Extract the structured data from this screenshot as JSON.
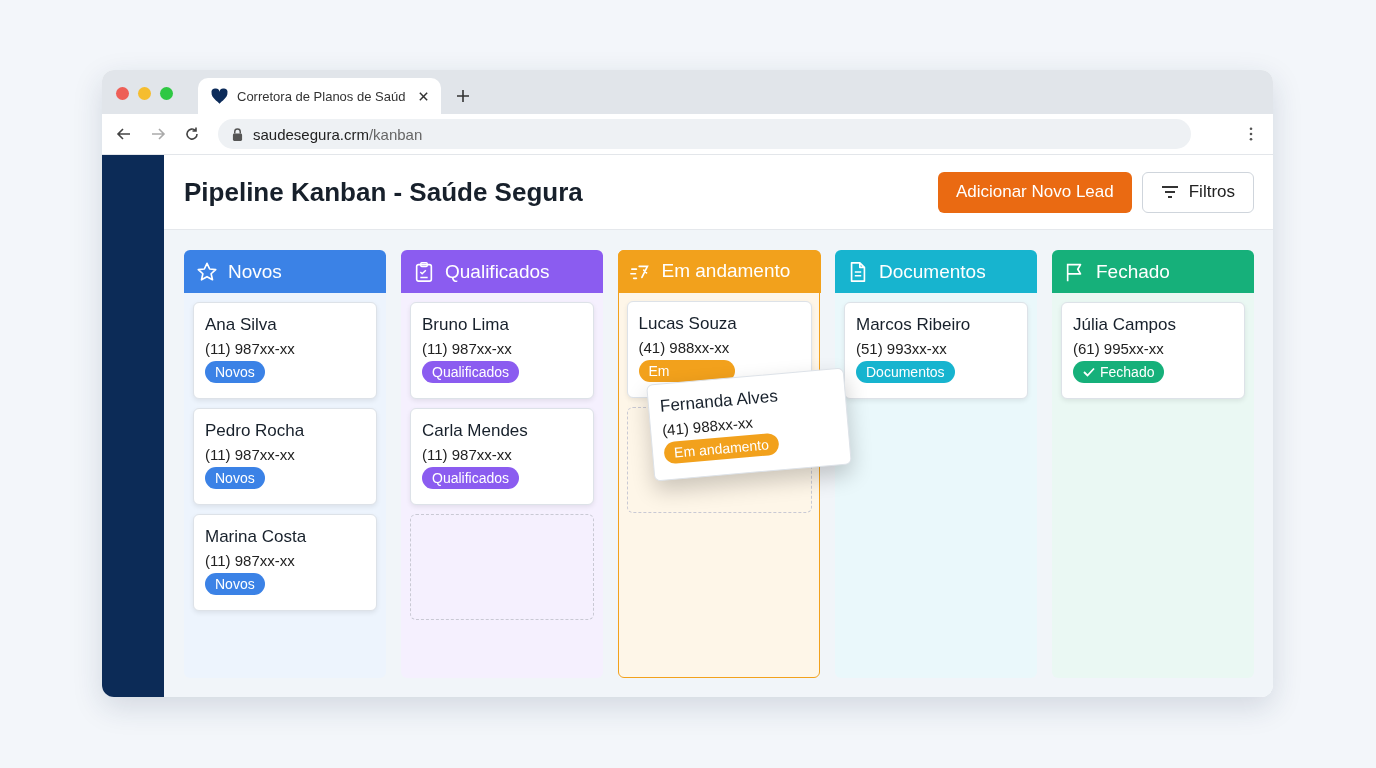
{
  "browser": {
    "tab_title": "Corretora de Planos de Saúd",
    "url_domain": "saudesegura.crm",
    "url_path": "/kanban"
  },
  "header": {
    "title": "Pipeline Kanban - Saúde Segura",
    "primary_button": "Adicionar Novo Lead",
    "filter_button": "Filtros"
  },
  "columns": [
    {
      "title": "Novos",
      "kind": "new",
      "color": "#3b82e6",
      "highlighted": false,
      "drop_zone": false,
      "cards": [
        {
          "name": "Ana Silva",
          "phone": "(11) 987xx-xx",
          "badge": "Novos"
        },
        {
          "name": "Pedro Rocha",
          "phone": "(11) 987xx-xx",
          "badge": "Novos"
        },
        {
          "name": "Marina Costa",
          "phone": "(11) 987xx-xx",
          "badge": "Novos"
        }
      ]
    },
    {
      "title": "Qualificados",
      "kind": "qualified",
      "color": "#8b5cf0",
      "highlighted": false,
      "drop_zone": true,
      "cards": [
        {
          "name": "Bruno Lima",
          "phone": "(11) 987xx-xx",
          "badge": "Qualificados"
        },
        {
          "name": "Carla Mendes",
          "phone": "(11) 987xx-xx",
          "badge": "Qualificados"
        }
      ]
    },
    {
      "title": "Em andamento",
      "kind": "progress",
      "color": "#f2a11c",
      "highlighted": true,
      "drop_zone": true,
      "cards": [
        {
          "name": "Lucas Souza",
          "phone": "(41) 988xx-xx",
          "badge": "Em"
        }
      ]
    },
    {
      "title": "Documentos",
      "kind": "documents",
      "color": "#17b4cf",
      "highlighted": false,
      "drop_zone": false,
      "cards": [
        {
          "name": "Marcos Ribeiro",
          "phone": "(51) 993xx-xx",
          "badge": "Documentos"
        }
      ]
    },
    {
      "title": "Fechado",
      "kind": "closed",
      "color": "#16b07a",
      "highlighted": false,
      "drop_zone": false,
      "cards": [
        {
          "name": "Júlia Campos",
          "phone": "(61) 995xx-xx",
          "badge": "Fechado"
        }
      ]
    }
  ],
  "dragging": {
    "name": "Fernanda Alves",
    "phone": "(41) 988xx-xx",
    "badge": "Em andamento",
    "color": "#f2a11c"
  }
}
